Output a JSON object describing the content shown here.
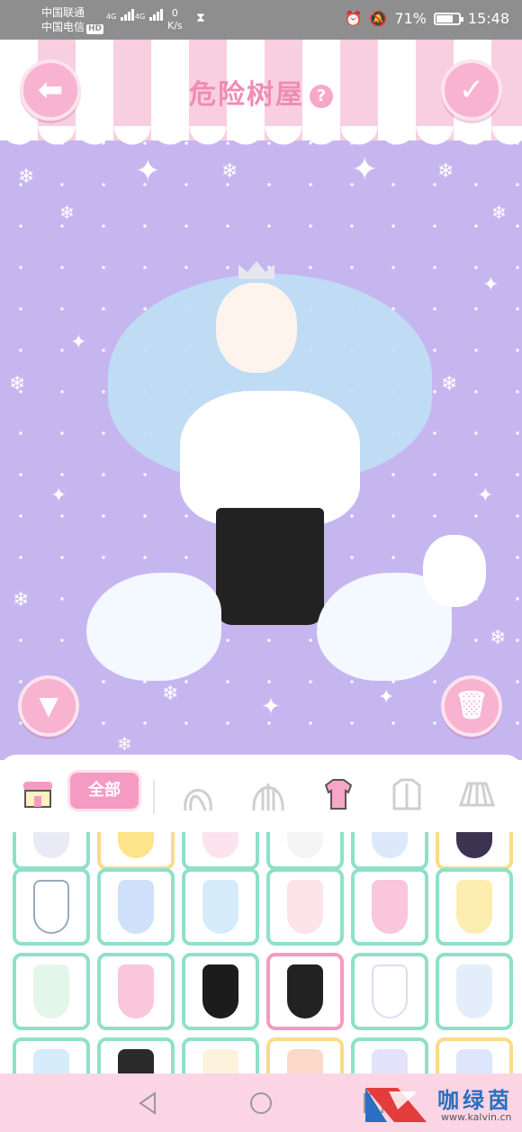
{
  "status_bar": {
    "carrier_1": "中国联通",
    "carrier_2": "中国电信",
    "hd_badge": "HD",
    "network_1": "4G",
    "network_2": "4G",
    "net_speed_value": "0",
    "net_speed_unit": "K/s",
    "battery_percent": "71%",
    "time": "15:48"
  },
  "header": {
    "title": "危险树屋",
    "help_icon": "question-mark-icon",
    "back_icon": "arrow-left-icon",
    "confirm_icon": "checkmark-icon"
  },
  "scene": {
    "collapse_icon": "triangle-down-icon",
    "trash_icon": "trash-icon"
  },
  "categories": {
    "shop_icon": "shop-icon",
    "all_label": "全部",
    "items": [
      "hair-front-icon",
      "hair-back-icon",
      "top-icon",
      "jacket-icon",
      "skirt-icon"
    ],
    "selected": "top-icon"
  },
  "colors": {
    "accent_pink": "#f59bc1",
    "tile_border": "#8fe0c8",
    "tile_locked_border": "#fadb8a",
    "background_lavender": "#c6b6f0"
  },
  "nav": {
    "back_icon": "nav-back-icon",
    "home_icon": "nav-home-icon",
    "recents_icon": "nav-recents-icon"
  },
  "watermark": {
    "name": "咖绿茵",
    "url": "www.kalvin.cn"
  }
}
